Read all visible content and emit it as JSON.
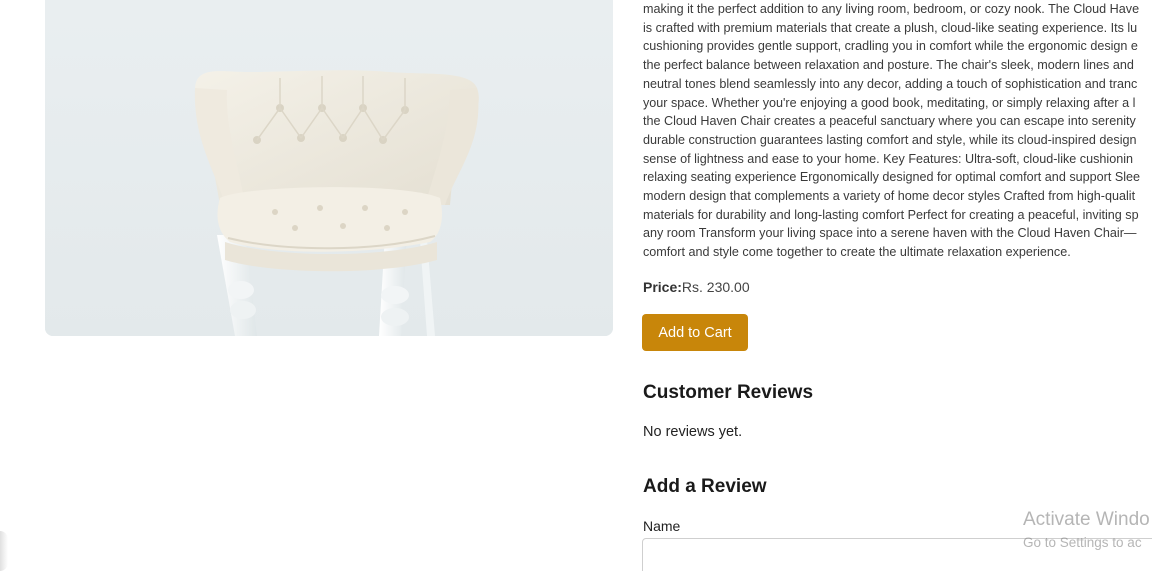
{
  "product": {
    "image_alt": "Cloud Haven Chair",
    "description_lines": [
      "making it the perfect addition to any living room, bedroom, or cozy nook. The Cloud Have",
      "is crafted with premium materials that create a plush, cloud-like seating experience. Its lu",
      "cushioning provides gentle support, cradling you in comfort while the ergonomic design e",
      "the perfect balance between relaxation and posture. The chair's sleek, modern lines and",
      "neutral tones blend seamlessly into any decor, adding a touch of sophistication and tranc",
      "your space. Whether you're enjoying a good book, meditating, or simply relaxing after a l",
      "the Cloud Haven Chair creates a peaceful sanctuary where you can escape into serenity",
      "durable construction guarantees lasting comfort and style, while its cloud-inspired design",
      "sense of lightness and ease to your home. Key Features: Ultra-soft, cloud-like cushionin",
      "relaxing seating experience Ergonomically designed for optimal comfort and support Slee",
      "modern design that complements a variety of home decor styles Crafted from high-qualit",
      "materials for durability and long-lasting comfort Perfect for creating a peaceful, inviting sp",
      "any room Transform your living space into a serene haven with the Cloud Haven Chair—",
      "comfort and style come together to create the ultimate relaxation experience."
    ],
    "price_label": "Price:",
    "price_value": "Rs. 230.00",
    "add_to_cart_label": "Add to Cart"
  },
  "reviews": {
    "title": "Customer Reviews",
    "empty_text": "No reviews yet."
  },
  "add_review": {
    "title": "Add a Review",
    "name_label": "Name",
    "name_value": ""
  },
  "watermark": {
    "title": "Activate Windo",
    "subtitle": "Go to Settings to ac"
  },
  "colors": {
    "accent": "#c8860a",
    "text": "#333333"
  }
}
